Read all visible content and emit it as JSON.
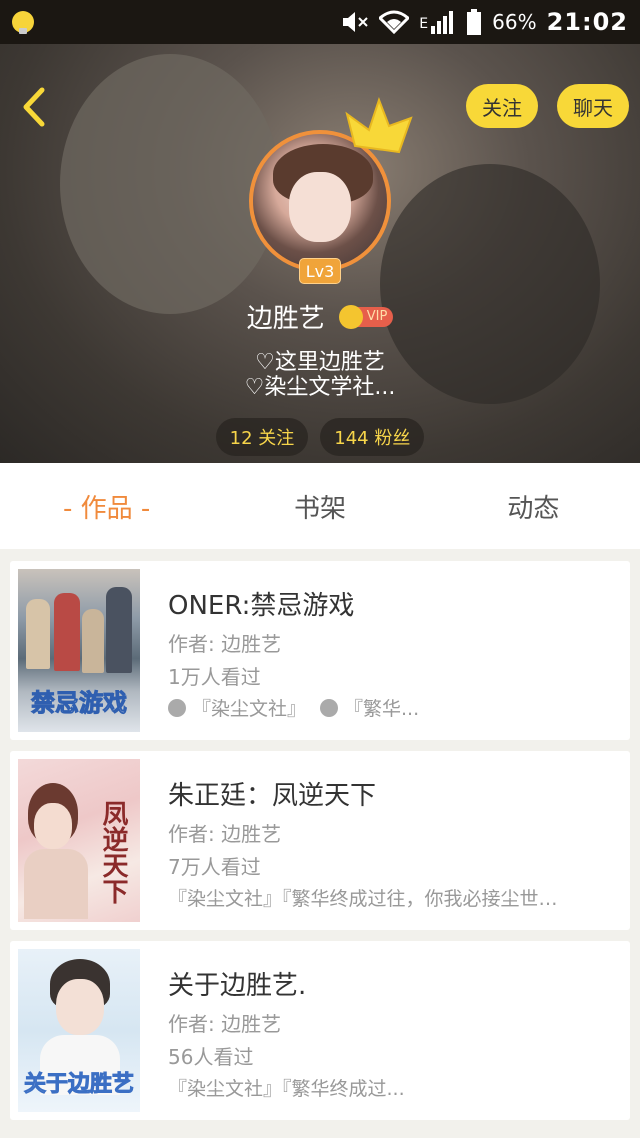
{
  "status_bar": {
    "battery": "66%",
    "time": "21:02",
    "network": "E",
    "icons": [
      "notification-bulb-icon",
      "mute-icon",
      "wifi-icon",
      "signal-icon",
      "battery-icon"
    ]
  },
  "header": {
    "follow_label": "关注",
    "chat_label": "聊天",
    "level": "Lv3",
    "username": "边胜艺",
    "vip_label": "VIP",
    "bio_line1": "♡这里边胜艺",
    "bio_line2": "♡染尘文学社...",
    "following": "12 关注",
    "fans": "144 粉丝"
  },
  "tabs": [
    "- 作品 -",
    "书架",
    "动态"
  ],
  "books": [
    {
      "title": "ONER:禁忌游戏",
      "author": "作者: 边胜艺",
      "views": "1万人看过",
      "tag1": "『染尘文社』",
      "tag2": "『繁华...",
      "cover_text": "禁忌游戏"
    },
    {
      "title": "朱正廷：凤逆天下",
      "author": "作者: 边胜艺",
      "views": "7万人看过",
      "tags": "『染尘文社』『繁华终成过往，你我必接尘世…",
      "cover_text": "凤逆天下"
    },
    {
      "title": "关于边胜艺.",
      "author": "作者: 边胜艺",
      "views": "56人看过",
      "tags": "『染尘文社』『繁华终成过...",
      "cover_text": "关于边胜艺"
    }
  ],
  "colors": {
    "accent_yellow": "#f8d838",
    "accent_orange": "#f08a3c",
    "stat_text": "#f7d54a"
  }
}
